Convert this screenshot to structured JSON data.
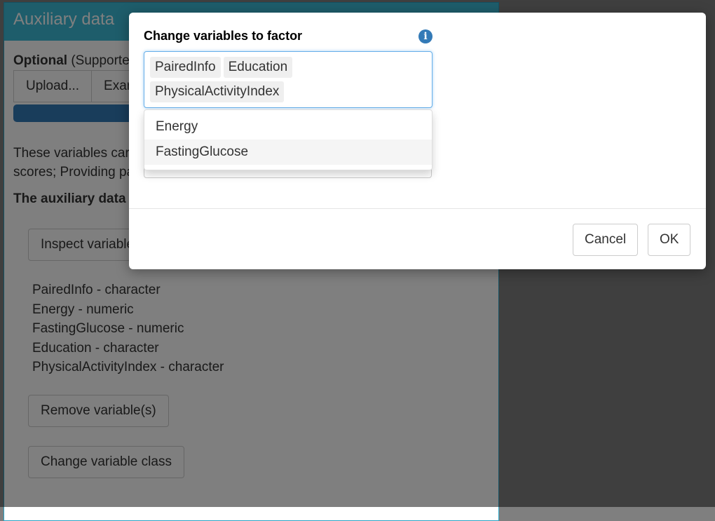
{
  "panel": {
    "title": "Auxiliary data",
    "optional_bold": "Optional",
    "optional_rest": " (Supporte",
    "upload_label": "Upload...",
    "example_label": "Exar",
    "description_lines": [
      "These variables car",
      "scores; Providing pa"
    ],
    "aux_title": "The auxiliary data",
    "inspect_label": "Inspect variable",
    "variables": [
      "PairedInfo - character",
      "Energy - numeric",
      "FastingGlucose - numeric",
      "Education - character",
      "PhysicalActivityIndex - character"
    ],
    "remove_label": "Remove variable(s)",
    "change_class_label": "Change variable class"
  },
  "modal": {
    "label": "Change variables to factor",
    "info_icon": "info-circle-icon",
    "selected": [
      "PairedInfo",
      "Education",
      "PhysicalActivityIndex"
    ],
    "options": [
      "Energy",
      "FastingGlucose"
    ],
    "highlighted_option": "FastingGlucose",
    "cancel_label": "Cancel",
    "ok_label": "OK"
  }
}
